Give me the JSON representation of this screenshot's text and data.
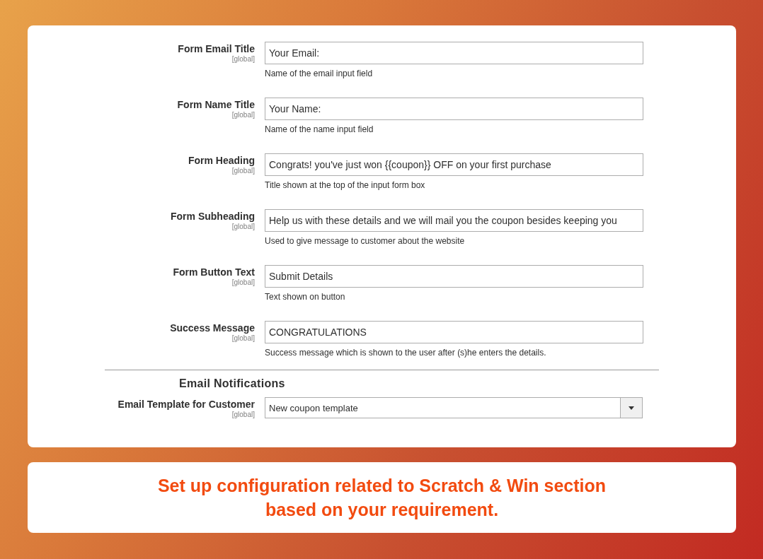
{
  "settings": [
    {
      "label": "Form Email Title",
      "scope": "[global]",
      "value": "Your Email:",
      "hint": "Name of the email input field"
    },
    {
      "label": "Form Name Title",
      "scope": "[global]",
      "value": "Your Name:",
      "hint": "Name of the name input field"
    },
    {
      "label": "Form Heading",
      "scope": "[global]",
      "value": "Congrats! you've just won {{coupon}} OFF on your first purchase",
      "hint": "Title shown at the top of the input form box"
    },
    {
      "label": "Form Subheading",
      "scope": "[global]",
      "value": "Help us with these details and we will mail you the coupon besides keeping you",
      "hint": "Used to give message to customer about the website"
    },
    {
      "label": "Form Button Text",
      "scope": "[global]",
      "value": "Submit Details",
      "hint": "Text shown on button"
    },
    {
      "label": "Success Message",
      "scope": "[global]",
      "value": "CONGRATULATIONS",
      "hint": "Success message which is shown to the user after (s)he enters the details."
    }
  ],
  "email_notifications": {
    "heading": "Email Notifications",
    "label": "Email Template for Customer",
    "scope": "[global]",
    "value": "New coupon template"
  },
  "caption": {
    "lines": [
      "Set up configuration related to Scratch & Win section",
      "based on your requirement."
    ]
  }
}
